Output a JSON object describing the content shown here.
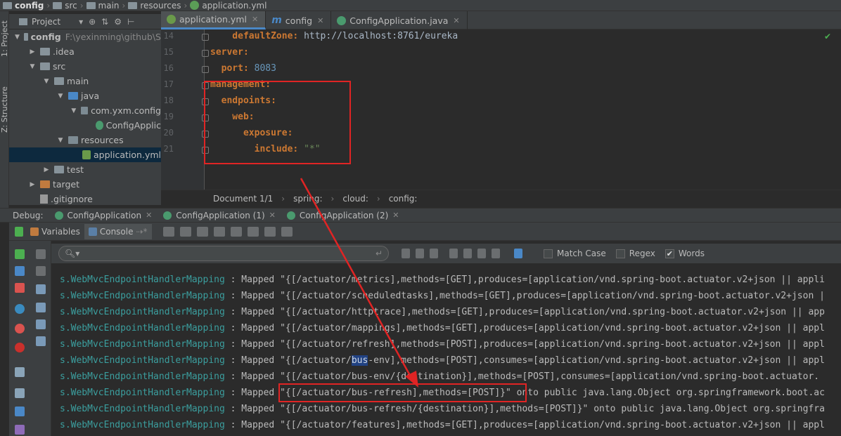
{
  "breadcrumb": [
    "config",
    "src",
    "main",
    "resources",
    "application.yml"
  ],
  "left_strip": {
    "project_label": "1: Project",
    "structure_label": "Z: Structure"
  },
  "project_panel": {
    "title": "Project"
  },
  "tree": [
    {
      "label": "config",
      "suffix": "F:\\yexinming\\github\\S",
      "level": 0,
      "open": true,
      "icon": "folder-icon"
    },
    {
      "label": ".idea",
      "level": 1,
      "open": false,
      "icon": "folder-icon"
    },
    {
      "label": "src",
      "level": 1,
      "open": true,
      "icon": "folder-icon"
    },
    {
      "label": "main",
      "level": 2,
      "open": true,
      "icon": "folder-icon"
    },
    {
      "label": "java",
      "level": 3,
      "open": true,
      "icon": "source-folder-icon"
    },
    {
      "label": "com.yxm.config",
      "level": 4,
      "open": true,
      "icon": "package-icon"
    },
    {
      "label": "ConfigApplic",
      "level": 5,
      "icon": "spring-class-icon"
    },
    {
      "label": "resources",
      "level": 3,
      "open": true,
      "icon": "resources-folder-icon"
    },
    {
      "label": "application.yml",
      "level": 4,
      "icon": "yml-file-icon",
      "selected": true
    },
    {
      "label": "test",
      "level": 2,
      "open": false,
      "icon": "folder-icon"
    },
    {
      "label": "target",
      "level": 1,
      "open": false,
      "icon": "target-folder-icon"
    },
    {
      "label": ".gitignore",
      "level": 1,
      "icon": "gitignore-icon"
    }
  ],
  "tabs": [
    {
      "label": "application.yml",
      "active": true
    },
    {
      "label": "config",
      "active": false
    },
    {
      "label": "ConfigApplication.java",
      "active": false
    }
  ],
  "editor": {
    "lines": [
      {
        "num": "14",
        "parts": [
          [
            "k",
            "    defaultZone: "
          ],
          [
            "v",
            "http://localhost:8761/eureka"
          ]
        ]
      },
      {
        "num": "15",
        "parts": [
          [
            "k",
            "server:"
          ]
        ]
      },
      {
        "num": "16",
        "parts": [
          [
            "k",
            "  port: "
          ],
          [
            "n",
            "8083"
          ]
        ]
      },
      {
        "num": "17",
        "parts": [
          [
            "k",
            "management:"
          ]
        ]
      },
      {
        "num": "18",
        "parts": [
          [
            "k",
            "  endpoints:"
          ]
        ]
      },
      {
        "num": "19",
        "parts": [
          [
            "k",
            "    web:"
          ]
        ]
      },
      {
        "num": "20",
        "parts": [
          [
            "k",
            "      exposure:"
          ]
        ]
      },
      {
        "num": "21",
        "parts": [
          [
            "k",
            "        include: "
          ],
          [
            "s",
            "\"*\""
          ]
        ]
      }
    ]
  },
  "editor_status": {
    "doc": "Document 1/1",
    "path": [
      "spring:",
      "cloud:",
      "config:"
    ]
  },
  "debug": {
    "label": "Debug:",
    "sessions": [
      "ConfigApplication",
      "ConfigApplication (1)",
      "ConfigApplication (2)"
    ]
  },
  "subtabs": {
    "variables": "Variables",
    "console": "Console"
  },
  "search": {
    "placeholder": "",
    "match_case": "Match Case",
    "regex": "Regex",
    "words": "Words"
  },
  "console": [
    {
      "cls": "s.WebMvcEndpointHandlerMapping",
      "msg": " : Mapped \"{[/actuator/metrics],methods=[GET],produces=[application/vnd.spring-boot.actuator.v2+json || appli"
    },
    {
      "cls": "s.WebMvcEndpointHandlerMapping",
      "msg": " : Mapped \"{[/actuator/scheduledtasks],methods=[GET],produces=[application/vnd.spring-boot.actuator.v2+json |"
    },
    {
      "cls": "s.WebMvcEndpointHandlerMapping",
      "msg": " : Mapped \"{[/actuator/httptrace],methods=[GET],produces=[application/vnd.spring-boot.actuator.v2+json || app"
    },
    {
      "cls": "s.WebMvcEndpointHandlerMapping",
      "msg": " : Mapped \"{[/actuator/mappings],methods=[GET],produces=[application/vnd.spring-boot.actuator.v2+json || appl"
    },
    {
      "cls": "s.WebMvcEndpointHandlerMapping",
      "msg": " : Mapped \"{[/actuator/refresh],methods=[POST],produces=[application/vnd.spring-boot.actuator.v2+json || appl"
    },
    {
      "cls": "s.WebMvcEndpointHandlerMapping",
      "msg_pre": " : Mapped \"{[/actuator/",
      "msg_hl": "bus",
      "msg_post": "-env],methods=[POST],consumes=[application/vnd.spring-boot.actuator.v2+json || appl"
    },
    {
      "cls": "s.WebMvcEndpointHandlerMapping",
      "msg": " : Mapped \"{[/actuator/bus-env/{destination}],methods=[POST],consumes=[application/vnd.spring-boot.actuator."
    },
    {
      "cls": "s.WebMvcEndpointHandlerMapping",
      "msg": " : Mapped \"{[/actuator/bus-refresh],methods=[POST]}\" onto public java.lang.Object org.springframework.boot.ac"
    },
    {
      "cls": "s.WebMvcEndpointHandlerMapping",
      "msg": " : Mapped \"{[/actuator/bus-refresh/{destination}],methods=[POST]}\" onto public java.lang.Object org.springfra"
    },
    {
      "cls": "s.WebMvcEndpointHandlerMapping",
      "msg": " : Mapped \"{[/actuator/features],methods=[GET],produces=[application/vnd.spring-boot.actuator.v2+json || appl"
    }
  ],
  "colors": {
    "annotation": "#e02424",
    "keyword": "#cc7832",
    "console_class": "#3b9e9e"
  }
}
